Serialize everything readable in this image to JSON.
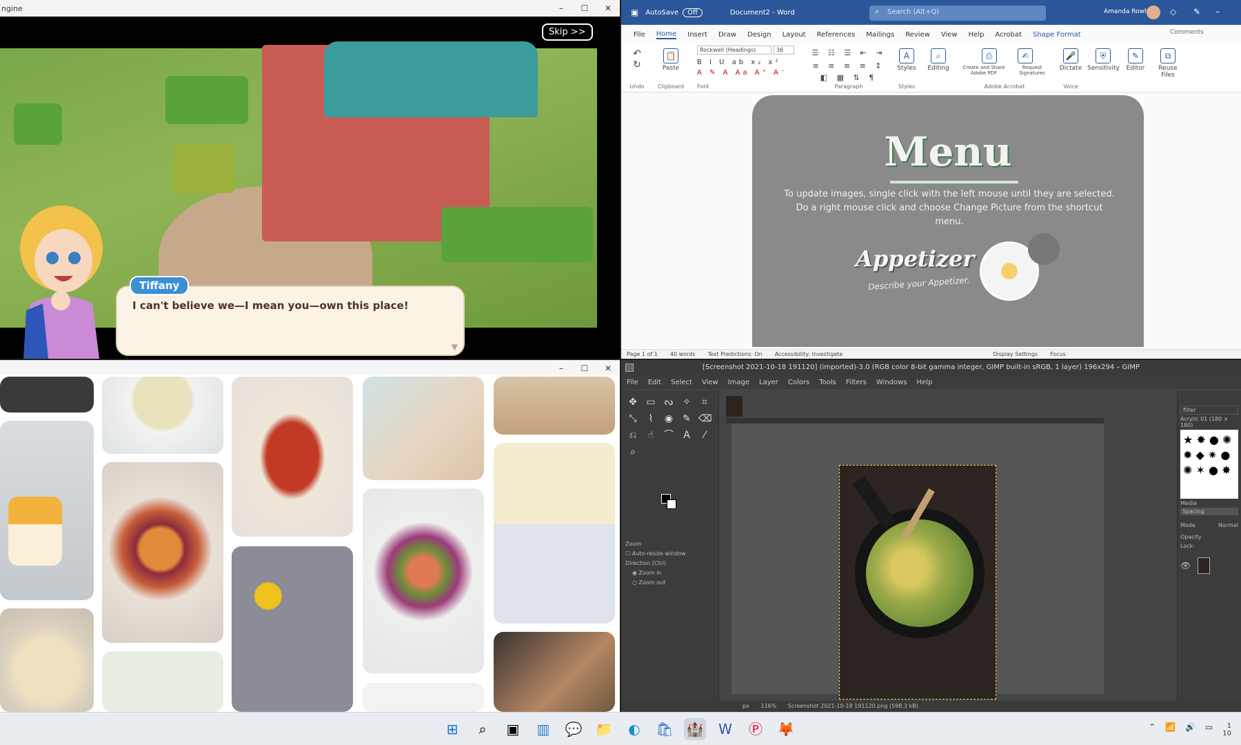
{
  "game": {
    "skip_label": "Skip >>",
    "speaker": "Tiffany",
    "dialog": "I can't believe we—I mean you—own this place!",
    "window_title": "ngine"
  },
  "word": {
    "autosave": "AutoSave",
    "autosave_state": "Off",
    "doc_name": "Document2 - Word",
    "search_placeholder": "Search (Alt+Q)",
    "user": "Amanda Rowly",
    "tabs": [
      "File",
      "Home",
      "Insert",
      "Draw",
      "Design",
      "Layout",
      "References",
      "Mailings",
      "Review",
      "View",
      "Help",
      "Acrobat",
      "Shape Format"
    ],
    "active_tab": "Home",
    "font_name": "Rockwell (Headings)",
    "font_size": "36",
    "groups": {
      "undo": "Undo",
      "clipboard": "Clipboard",
      "paste": "Paste",
      "font": "Font",
      "paragraph": "Paragraph",
      "styles": "Styles",
      "styles_btn": "Styles",
      "editing": "Editing",
      "create_share": "Create and Share Adobe PDF",
      "request_sig": "Request Signatures",
      "adobe_acrobat": "Adobe Acrobat",
      "dictate": "Dictate",
      "voice": "Voice",
      "sensitivity": "Sensitivity",
      "editor": "Editor",
      "reuse_files": "Reuse Files"
    },
    "comments_btn": "Comments",
    "menu_title": "Menu",
    "menu_body": "To update images, single click with the left mouse until they are selected. Do a right mouse click and choose Change Picture from the shortcut menu.",
    "appetizer": "Appetizer",
    "appetizer_desc": "Describe your Appetizer.",
    "status": {
      "page": "Page 1 of 1",
      "words": "40 words",
      "predictions": "Text Predictions: On",
      "accessibility": "Accessibility: Investigate",
      "display": "Display Settings",
      "focus": "Focus"
    }
  },
  "gimp": {
    "title": "[Screenshot 2021-10-18 191120] (imported)-3.0 (RGB color 8-bit gamma integer, GIMP built-in sRGB, 1 layer) 196x294 – GIMP",
    "menu": [
      "File",
      "Edit",
      "Select",
      "View",
      "Image",
      "Layer",
      "Colors",
      "Tools",
      "Filters",
      "Windows",
      "Help"
    ],
    "tool_options": {
      "zoom": "Zoom",
      "auto_resize": "Auto-resize window",
      "direction": "Direction  (Ctrl)",
      "zoom_in": "Zoom in",
      "zoom_out": "Zoom out"
    },
    "status": "Screenshot 2021-10-18 191120.png (598.3 kB)",
    "zoom_unit": "px",
    "zoom_level": "116%",
    "dock": {
      "filter": "filter",
      "brush_name": "Acrylic 01 (180 × 180)",
      "media": "Media",
      "spacing": "Spacing",
      "mode_label": "Mode",
      "mode_value": "Normal",
      "opacity": "Opacity",
      "lock": "Lock:"
    }
  },
  "taskbar": {
    "icons": [
      "windows-start",
      "search",
      "task-view",
      "widgets",
      "chat",
      "file-explorer",
      "edge",
      "store",
      "gardenscapes",
      "word",
      "pinterest",
      "gimp"
    ],
    "time": "1",
    "date": "10"
  },
  "colors": {
    "word_blue": "#2b579a",
    "gimp_bg": "#454545",
    "taskbar": "#e9ecf1"
  }
}
